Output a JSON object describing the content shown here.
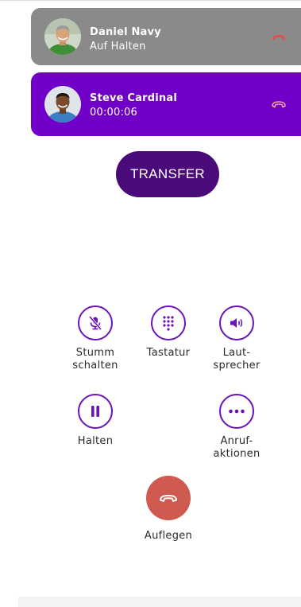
{
  "calls": [
    {
      "name": "Daniel Navy",
      "status": "Auf Halten",
      "state": "held",
      "card_color": "#8a8a8a",
      "hangup_icon_color": "#d9534f",
      "avatar_icon": "man-avatar"
    },
    {
      "name": "Steve Cardinal",
      "status": "00:00:06",
      "state": "active",
      "card_color": "#7000c8",
      "hangup_icon_color": "#f0a0a0",
      "avatar_icon": "man-avatar"
    }
  ],
  "transfer": {
    "label": "TRANSFER",
    "color": "#4a0a7a"
  },
  "controls": {
    "mute": {
      "label": "Stumm\nschalten",
      "icon": "mic-off-icon"
    },
    "keypad": {
      "label": "Tastatur",
      "icon": "dialpad-icon"
    },
    "speaker": {
      "label": "Laut-\nsprecher",
      "icon": "speaker-icon"
    },
    "hold": {
      "label": "Halten",
      "icon": "pause-icon"
    },
    "call_actions": {
      "label": "Anruf-\naktionen",
      "icon": "more-icon"
    },
    "hangup": {
      "label": "Auflegen",
      "icon": "hang-up-icon"
    }
  },
  "colors": {
    "accent": "#6a14b8",
    "hangup": "#cf5a4f"
  }
}
